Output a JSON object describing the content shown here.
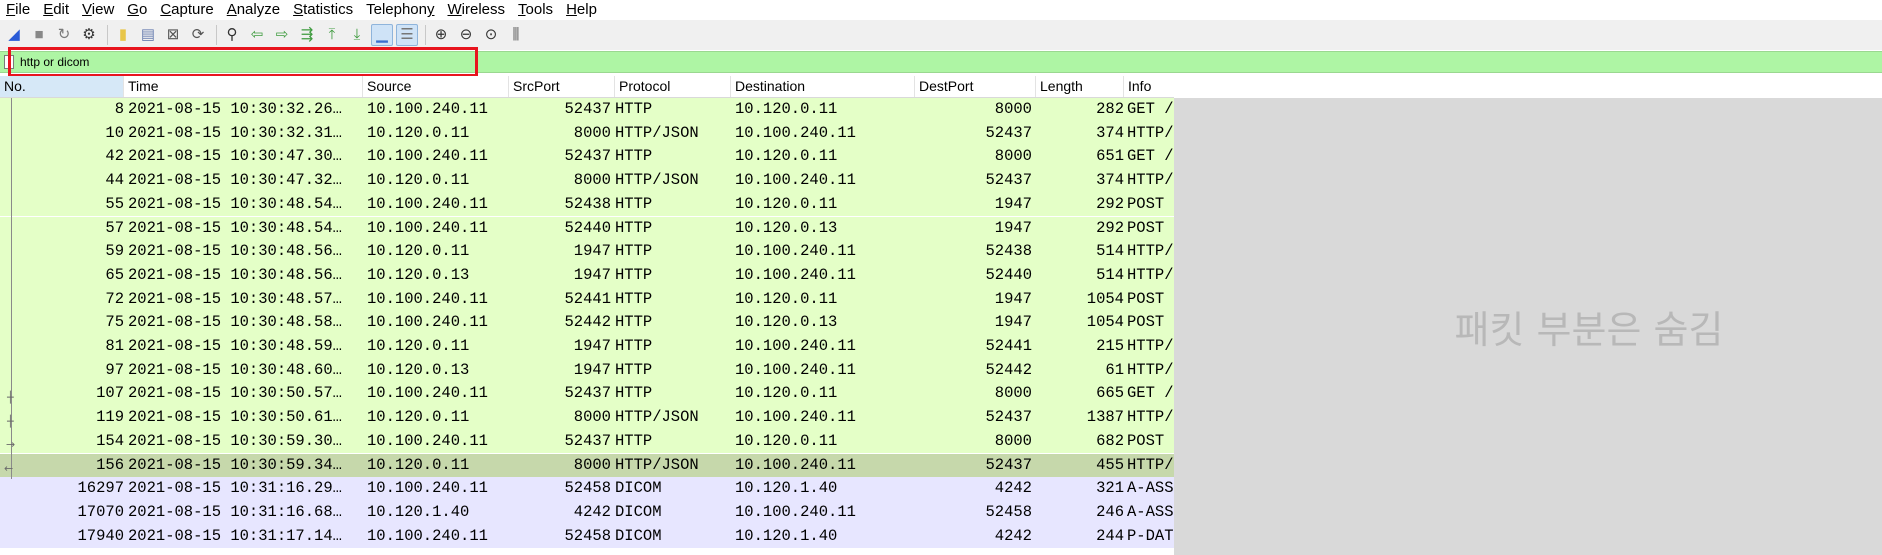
{
  "menu": [
    {
      "key": "F",
      "rest": "ile"
    },
    {
      "key": "E",
      "rest": "dit"
    },
    {
      "key": "V",
      "rest": "iew"
    },
    {
      "key": "G",
      "rest": "o"
    },
    {
      "key": "C",
      "rest": "apture"
    },
    {
      "key": "A",
      "rest": "nalyze"
    },
    {
      "key": "S",
      "rest": "tatistics"
    },
    {
      "key": "",
      "rest": "Telephon",
      "key2": "y"
    },
    {
      "key": "W",
      "rest": "ireless"
    },
    {
      "key": "T",
      "rest": "ools"
    },
    {
      "key": "H",
      "rest": "elp"
    }
  ],
  "toolbar_icons": [
    {
      "name": "shark-fin-start-icon",
      "glyph": "◢",
      "color": "#2a5bd7"
    },
    {
      "name": "stop-capture-icon",
      "glyph": "■",
      "color": "#888888"
    },
    {
      "name": "restart-capture-icon",
      "glyph": "↻",
      "color": "#7a7a7a"
    },
    {
      "name": "capture-options-icon",
      "glyph": "⚙",
      "color": "#333333"
    },
    {
      "name": "sep"
    },
    {
      "name": "open-file-icon",
      "glyph": "▮",
      "color": "#e8c64a"
    },
    {
      "name": "save-file-icon",
      "glyph": "▤",
      "color": "#6a7fb0"
    },
    {
      "name": "close-file-icon",
      "glyph": "⊠",
      "color": "#555555"
    },
    {
      "name": "reload-file-icon",
      "glyph": "⟳",
      "color": "#555555"
    },
    {
      "name": "sep"
    },
    {
      "name": "find-packet-icon",
      "glyph": "⚲",
      "color": "#333333"
    },
    {
      "name": "go-back-icon",
      "glyph": "⇦",
      "color": "#3f9b3f"
    },
    {
      "name": "go-forward-icon",
      "glyph": "⇨",
      "color": "#3f9b3f"
    },
    {
      "name": "go-to-packet-icon",
      "glyph": "⇶",
      "color": "#3f9b3f"
    },
    {
      "name": "first-packet-icon",
      "glyph": "⤒",
      "color": "#3f9b3f"
    },
    {
      "name": "last-packet-icon",
      "glyph": "⤓",
      "color": "#3f9b3f"
    },
    {
      "name": "autoscroll-icon",
      "glyph": "▁",
      "color": "#3a6fd0",
      "active": true
    },
    {
      "name": "colorize-icon",
      "glyph": "☰",
      "color": "#777777",
      "active": true
    },
    {
      "name": "sep"
    },
    {
      "name": "zoom-in-icon",
      "glyph": "⊕",
      "color": "#333333"
    },
    {
      "name": "zoom-out-icon",
      "glyph": "⊖",
      "color": "#333333"
    },
    {
      "name": "zoom-normal-icon",
      "glyph": "⊙",
      "color": "#333333"
    },
    {
      "name": "resize-columns-icon",
      "glyph": "⫼",
      "color": "#555555"
    }
  ],
  "filter": {
    "value": "http or dicom"
  },
  "columns": [
    "No.",
    "Time",
    "Source",
    "SrcPort",
    "Protocol",
    "Destination",
    "DestPort",
    "Length",
    "Info"
  ],
  "packets": [
    {
      "no": "8",
      "time": "2021-08-15 10:30:32.26…",
      "src": "10.100.240.11",
      "sport": "52437",
      "proto": "HTTP",
      "dst": "10.120.0.11",
      "dport": "8000",
      "len": "282",
      "info": "GET /",
      "type": "http"
    },
    {
      "no": "10",
      "time": "2021-08-15 10:30:32.31…",
      "src": "10.120.0.11",
      "sport": "8000",
      "proto": "HTTP/JSON",
      "dst": "10.100.240.11",
      "dport": "52437",
      "len": "374",
      "info": "HTTP/",
      "type": "http"
    },
    {
      "no": "42",
      "time": "2021-08-15 10:30:47.30…",
      "src": "10.100.240.11",
      "sport": "52437",
      "proto": "HTTP",
      "dst": "10.120.0.11",
      "dport": "8000",
      "len": "651",
      "info": "GET /",
      "type": "http"
    },
    {
      "no": "44",
      "time": "2021-08-15 10:30:47.32…",
      "src": "10.120.0.11",
      "sport": "8000",
      "proto": "HTTP/JSON",
      "dst": "10.100.240.11",
      "dport": "52437",
      "len": "374",
      "info": "HTTP/",
      "type": "http"
    },
    {
      "no": "55",
      "time": "2021-08-15 10:30:48.54…",
      "src": "10.100.240.11",
      "sport": "52438",
      "proto": "HTTP",
      "dst": "10.120.0.11",
      "dport": "1947",
      "len": "292",
      "info": "POST",
      "type": "http"
    },
    {
      "no": "57",
      "time": "2021-08-15 10:30:48.54…",
      "src": "10.100.240.11",
      "sport": "52440",
      "proto": "HTTP",
      "dst": "10.120.0.13",
      "dport": "1947",
      "len": "292",
      "info": "POST",
      "type": "http"
    },
    {
      "no": "59",
      "time": "2021-08-15 10:30:48.56…",
      "src": "10.120.0.11",
      "sport": "1947",
      "proto": "HTTP",
      "dst": "10.100.240.11",
      "dport": "52438",
      "len": "514",
      "info": "HTTP/",
      "type": "http"
    },
    {
      "no": "65",
      "time": "2021-08-15 10:30:48.56…",
      "src": "10.120.0.13",
      "sport": "1947",
      "proto": "HTTP",
      "dst": "10.100.240.11",
      "dport": "52440",
      "len": "514",
      "info": "HTTP/",
      "type": "http"
    },
    {
      "no": "72",
      "time": "2021-08-15 10:30:48.57…",
      "src": "10.100.240.11",
      "sport": "52441",
      "proto": "HTTP",
      "dst": "10.120.0.11",
      "dport": "1947",
      "len": "1054",
      "info": "POST",
      "type": "http"
    },
    {
      "no": "75",
      "time": "2021-08-15 10:30:48.58…",
      "src": "10.100.240.11",
      "sport": "52442",
      "proto": "HTTP",
      "dst": "10.120.0.13",
      "dport": "1947",
      "len": "1054",
      "info": "POST",
      "type": "http"
    },
    {
      "no": "81",
      "time": "2021-08-15 10:30:48.59…",
      "src": "10.120.0.11",
      "sport": "1947",
      "proto": "HTTP",
      "dst": "10.100.240.11",
      "dport": "52441",
      "len": "215",
      "info": "HTTP/",
      "type": "http"
    },
    {
      "no": "97",
      "time": "2021-08-15 10:30:48.60…",
      "src": "10.120.0.13",
      "sport": "1947",
      "proto": "HTTP",
      "dst": "10.100.240.11",
      "dport": "52442",
      "len": "61",
      "info": "HTTP/",
      "type": "http"
    },
    {
      "no": "107",
      "time": "2021-08-15 10:30:50.57…",
      "src": "10.100.240.11",
      "sport": "52437",
      "proto": "HTTP",
      "dst": "10.120.0.11",
      "dport": "8000",
      "len": "665",
      "info": "GET /",
      "type": "http"
    },
    {
      "no": "119",
      "time": "2021-08-15 10:30:50.61…",
      "src": "10.120.0.11",
      "sport": "8000",
      "proto": "HTTP/JSON",
      "dst": "10.100.240.11",
      "dport": "52437",
      "len": "1387",
      "info": "HTTP/",
      "type": "http"
    },
    {
      "no": "154",
      "time": "2021-08-15 10:30:59.30…",
      "src": "10.100.240.11",
      "sport": "52437",
      "proto": "HTTP",
      "dst": "10.120.0.11",
      "dport": "8000",
      "len": "682",
      "info": "POST",
      "type": "http"
    },
    {
      "no": "156",
      "time": "2021-08-15 10:30:59.34…",
      "src": "10.120.0.11",
      "sport": "8000",
      "proto": "HTTP/JSON",
      "dst": "10.100.240.11",
      "dport": "52437",
      "len": "455",
      "info": "HTTP/",
      "type": "selected"
    },
    {
      "no": "16297",
      "time": "2021-08-15 10:31:16.29…",
      "src": "10.100.240.11",
      "sport": "52458",
      "proto": "DICOM",
      "dst": "10.120.1.40",
      "dport": "4242",
      "len": "321",
      "info": "A-ASS",
      "type": "dicom"
    },
    {
      "no": "17070",
      "time": "2021-08-15 10:31:16.68…",
      "src": "10.120.1.40",
      "sport": "4242",
      "proto": "DICOM",
      "dst": "10.100.240.11",
      "dport": "52458",
      "len": "246",
      "info": "A-ASS",
      "type": "dicom"
    },
    {
      "no": "17940",
      "time": "2021-08-15 10:31:17.14…",
      "src": "10.100.240.11",
      "sport": "52458",
      "proto": "DICOM",
      "dst": "10.120.1.40",
      "dport": "4242",
      "len": "244",
      "info": "P-DAT",
      "type": "dicom"
    }
  ],
  "overlay_text": "패킷 부분은 숨김",
  "colors": {
    "http_row": "#e4ffc7",
    "selected_row": "#c6d8ab",
    "dicom_row": "#e7e6ff",
    "filter_ok": "#aef5a4",
    "highlight": "#e8141e",
    "overlay": "#d9d9d9"
  }
}
